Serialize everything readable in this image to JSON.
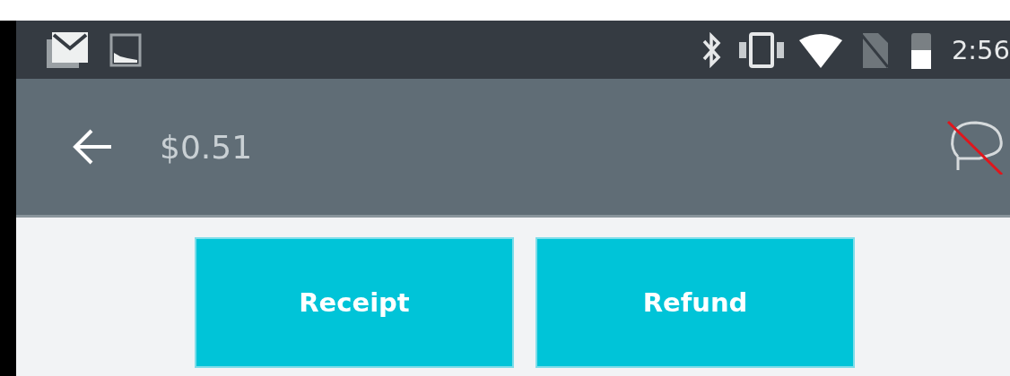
{
  "status_bar": {
    "time": "2:56"
  },
  "app_bar": {
    "title": "$0.51"
  },
  "buttons": [
    {
      "label": "Receipt"
    },
    {
      "label": "Refund"
    }
  ]
}
